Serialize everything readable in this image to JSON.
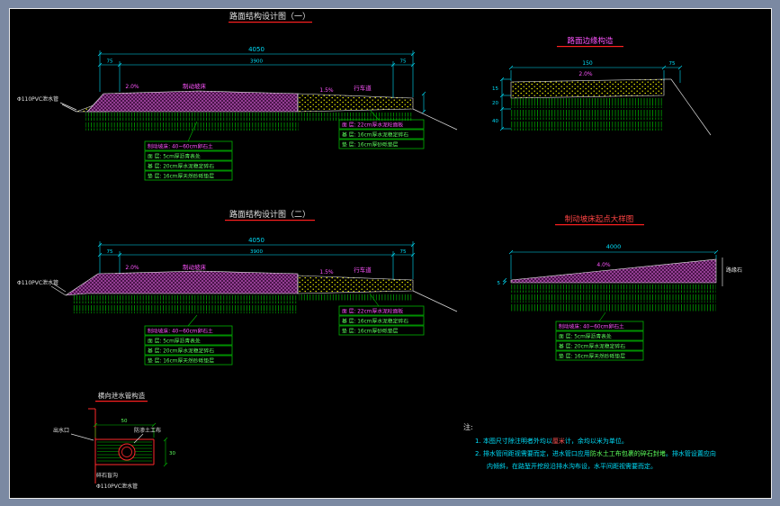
{
  "palette": {
    "background": "#7b89a2",
    "canvas": "#000000",
    "dimension_cyan": "#00dffb",
    "annotation_magenta": "#ff55ff",
    "layer_text_green": "#5cff5c",
    "hatch_purple": "#b24fb2",
    "hatch_yellow": "#ffff00",
    "hatch_green": "#00b400",
    "underline_red": "#ff2020"
  },
  "fig1": {
    "title": "路面结构设计图（一）",
    "dim_total": "4050",
    "dim_sub_left": "75",
    "dim_sub_mid": "3900",
    "dim_sub_right": "75",
    "slope_left": "2.0%",
    "zone_left": "制动坡床",
    "slope_right": "1.5%",
    "zone_right": "行车道",
    "drain_label": "Φ110PVC泄水管",
    "tableA": [
      "制动坡床: 40~60cm卵石土",
      "面 层: 5cm厚沥青表处",
      "基 层: 20cm厚水泥稳定碎石",
      "垫 层: 16cm厚天然砂砾垫层"
    ],
    "tableB": [
      "面 层: 22cm厚水泥砼面板",
      "基 层: 16cm厚水泥稳定碎石",
      "垫 层: 16cm厚砂砾垫层"
    ]
  },
  "fig2": {
    "title": "路面边缘构造",
    "dim_top": "150",
    "dim_right": "75",
    "slope": "2.0%",
    "dims_left": [
      "15",
      "20",
      "40"
    ]
  },
  "fig3": {
    "title": "路面结构设计图（二）",
    "dim_total": "4050",
    "dim_sub_left": "75",
    "dim_sub_mid": "3900",
    "dim_sub_right": "75",
    "slope_left": "2.0%",
    "zone_left": "制动坡床",
    "slope_right": "1.5%",
    "zone_right": "行车道",
    "drain_label": "Φ110PVC泄水管",
    "tableA": [
      "制动坡床: 40~60cm卵石土",
      "面 层: 5cm厚沥青表处",
      "基 层: 20cm厚水泥稳定碎石",
      "垫 层: 16cm厚天然砂砾垫层"
    ],
    "tableB": [
      "面 层: 22cm厚水泥砼面板",
      "基 层: 16cm厚水泥稳定碎石",
      "垫 层: 16cm厚砂砾垫层"
    ]
  },
  "fig4": {
    "title": "制动坡床起点大样图",
    "dim_top": "4000",
    "slope": "4.0%",
    "left_dim": "5",
    "right_label": "路缘石",
    "table": [
      "制动坡床: 40~60cm卵石土",
      "面 层: 5cm厚沥青表处",
      "基 层: 20cm厚水泥稳定碎石",
      "垫 层: 16cm厚天然砂砾垫层"
    ]
  },
  "fig5": {
    "title": "横向泄水管构造",
    "dim_top": "50",
    "dim_right": "30",
    "label_outlet": "出水口",
    "label_wrap": "防渗土工布",
    "label_gravel": "碎石盲沟",
    "label_pipe": "Φ110PVC泄水管"
  },
  "notes": {
    "heading": "注:",
    "l1a": "1. 本图尺寸除注明者外均以",
    "l1b": "厘米",
    "l1c": "计，余均以米为单位。",
    "l2a": "2. 排水管间距视需要而定，进水管口应用",
    "l2b": "防水土工布包裹的碎石封堵",
    "l2c": "。排水管设置应向",
    "l2d": "内倾斜，在路堑开挖段沿排水沟布设，水平间距视需要而定。"
  }
}
